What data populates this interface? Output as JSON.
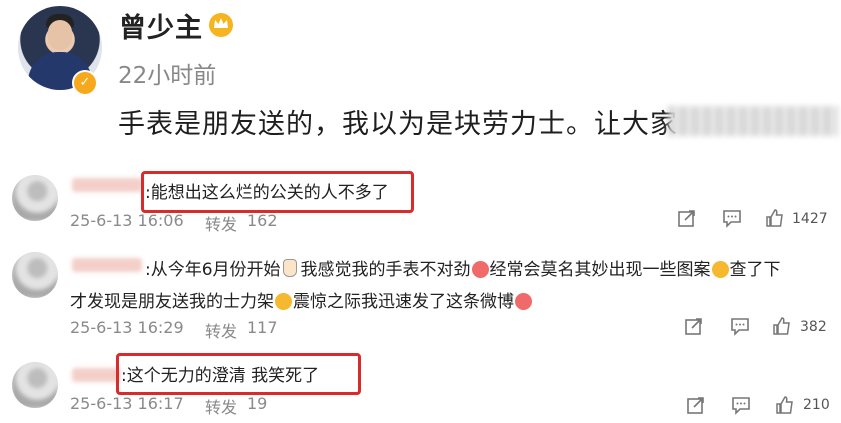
{
  "post": {
    "username": "曾少主",
    "time": "22小时前",
    "text": "手表是朋友送的，我以为是块劳力士。让大家"
  },
  "comments": [
    {
      "line1": ":能想出这么烂的公关的人不多了",
      "line2": "",
      "date": "25-6-13 16:06",
      "repost_label": "转发",
      "repost_count": "162",
      "like_count": "1427"
    },
    {
      "line1a": ":从今年6月份开始",
      "line1b": "我感觉我的手表不对劲",
      "line1c": "经常会莫名其妙出现一些图案",
      "line1d": "查了下",
      "line2a": "才发现是朋友送我的士力架",
      "line2b": "震惊之际我迅速发了这条微博",
      "date": "25-6-13 16:29",
      "repost_label": "转发",
      "repost_count": "117",
      "like_count": "382"
    },
    {
      "line1": ":这个无力的澄清 我笑死了",
      "date": "25-6-13 16:17",
      "repost_label": "转发",
      "repost_count": "19",
      "like_count": "210"
    }
  ],
  "icons": [
    "verified-badge-icon",
    "crown-icon",
    "share-icon",
    "comment-icon",
    "like-icon"
  ],
  "colors": {
    "highlight": "#d92b2b",
    "badge": "#f7a81b"
  }
}
